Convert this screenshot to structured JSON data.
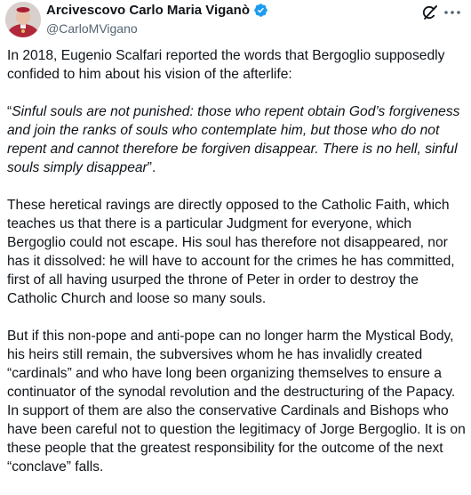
{
  "author": {
    "display_name": "Arcivescovo Carlo Maria Viganò",
    "handle": "@CarloMVigano"
  },
  "icons": {
    "verified": "verified-badge-icon",
    "grok": "grok-icon",
    "more": "more-options-icon"
  },
  "colors": {
    "verified_blue": "#1d9bf0",
    "text": "#0f1419",
    "secondary": "#536471"
  },
  "post": {
    "p1": "In 2018, Eugenio Scalfari reported the words that Bergoglio supposedly confided to him about his vision of the afterlife:",
    "quote_open": "“",
    "quote_text": "Sinful souls are not punished: those who repent obtain God’s forgiveness and join the ranks of souls who contemplate him, but those who do not repent and cannot therefore be forgiven disappear. There is no hell, sinful souls simply disappear",
    "quote_close": "”.",
    "p3": "These heretical ravings are directly opposed to the Catholic Faith, which teaches us that there is a particular Judgment for everyone, which Bergoglio could not escape. His soul has therefore not disappeared, nor has it dissolved: he will have to account for the crimes he has committed, first of all having usurped the throne of Peter in order to destroy the Catholic Church and loose so many souls.",
    "p4": "But if this non-pope and anti-pope can no longer harm the Mystical Body, his heirs still remain, the subversives whom he has invalidly created “cardinals” and who have long been organizing themselves to ensure a continuator of the synodal revolution and the destructuring of the Papacy. In support of them are also the conservative Cardinals and Bishops who have been careful not to question the legitimacy of Jorge Bergoglio. It is on these people that the greatest responsibility for the outcome of the next “conclave” falls."
  }
}
